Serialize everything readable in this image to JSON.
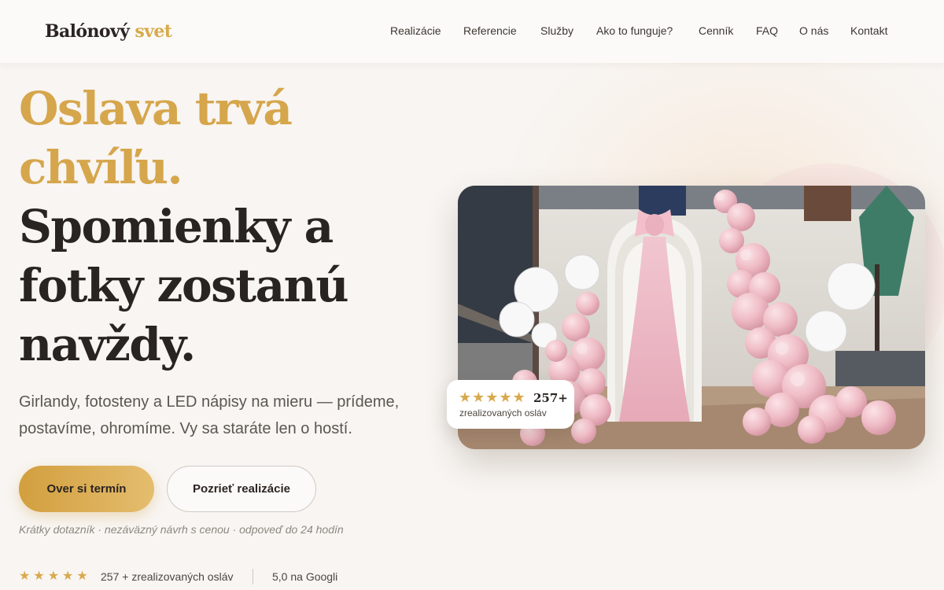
{
  "header": {
    "logo_main": "Balónový",
    "logo_accent": "svet",
    "nav": [
      "Realizácie",
      "Referencie",
      "Služby",
      "Ako to funguje?",
      "Cenník",
      "FAQ",
      "O nás",
      "Kontakt"
    ]
  },
  "hero": {
    "title_lines": [
      "Oslava trvá",
      "chvíľu.",
      "Spomienky a",
      "fotky zostanú",
      "navždy."
    ],
    "subtitle": "Girlandy, fotosteny a LED nápisy na mieru — prídeme, postavíme, ohromíme. Vy sa staráte len o hostí.",
    "cta_primary": "Over si termín",
    "cta_secondary": "Pozrieť realizácie",
    "note": "Krátky dotazník · nezáväzný návrh s cenou · odpoveď do 24 hodín",
    "proof": {
      "stars": "★★★★★",
      "rating": 5,
      "count_text": "257 + zrealizovaných osláv",
      "google_text": "5,0 na Googli"
    }
  },
  "rating_card": {
    "stars": "★★★★★",
    "number": "257+",
    "label": "zrealizovaných osláv"
  },
  "colors": {
    "accent_gold": "#d6a64c",
    "text_dark": "#292422",
    "background": "#f8f5f2"
  },
  "icons": [
    "star-icon"
  ]
}
